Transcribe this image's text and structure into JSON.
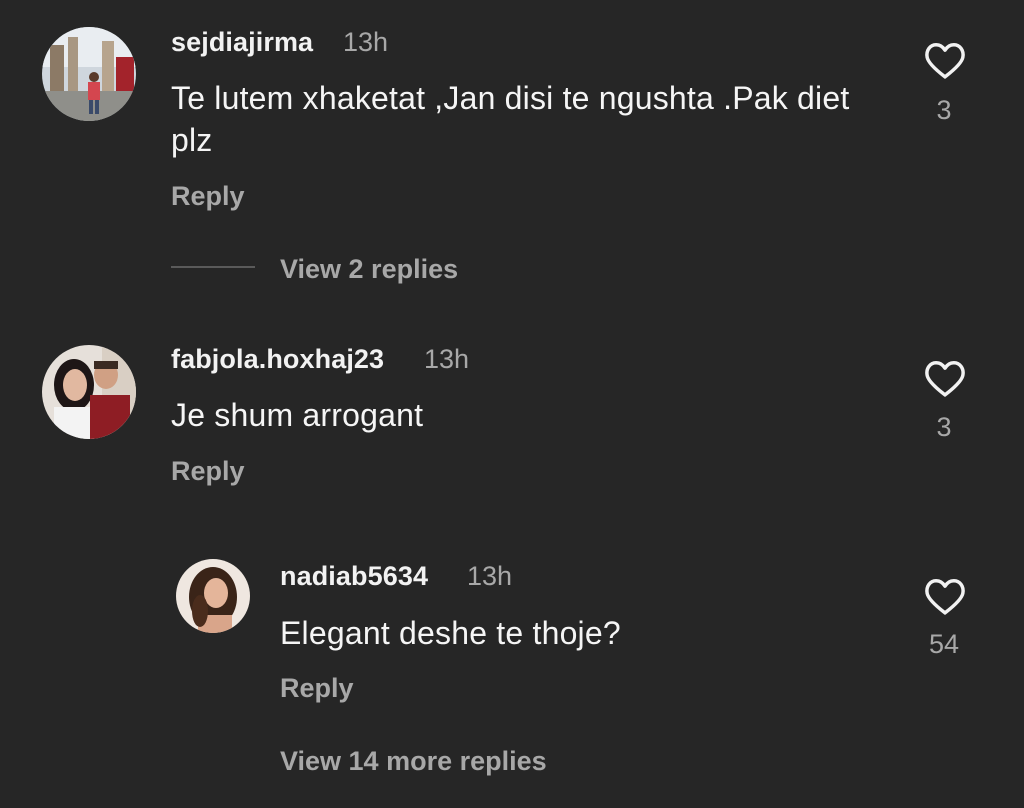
{
  "comments": [
    {
      "username": "sejdiajirma",
      "time": "13h",
      "text": "Te lutem xhaketat ,Jan disi te ngushta .Pak diet plz",
      "reply_label": "Reply",
      "like_count": "3",
      "view_replies_label": "View 2 replies"
    },
    {
      "username": "fabjola.hoxhaj23",
      "time": "13h",
      "text": "Je shum arrogant",
      "reply_label": "Reply",
      "like_count": "3"
    },
    {
      "username": "nadiab5634",
      "time": "13h",
      "text": "Elegant deshe te thoje?",
      "reply_label": "Reply",
      "like_count": "54",
      "view_replies_label": "View 14 more replies"
    }
  ],
  "colors": {
    "background": "#262626",
    "primary_text": "#f5f5f5",
    "secondary_text": "#a8a8a8"
  },
  "icons": {
    "like": "heart-outline-icon"
  }
}
